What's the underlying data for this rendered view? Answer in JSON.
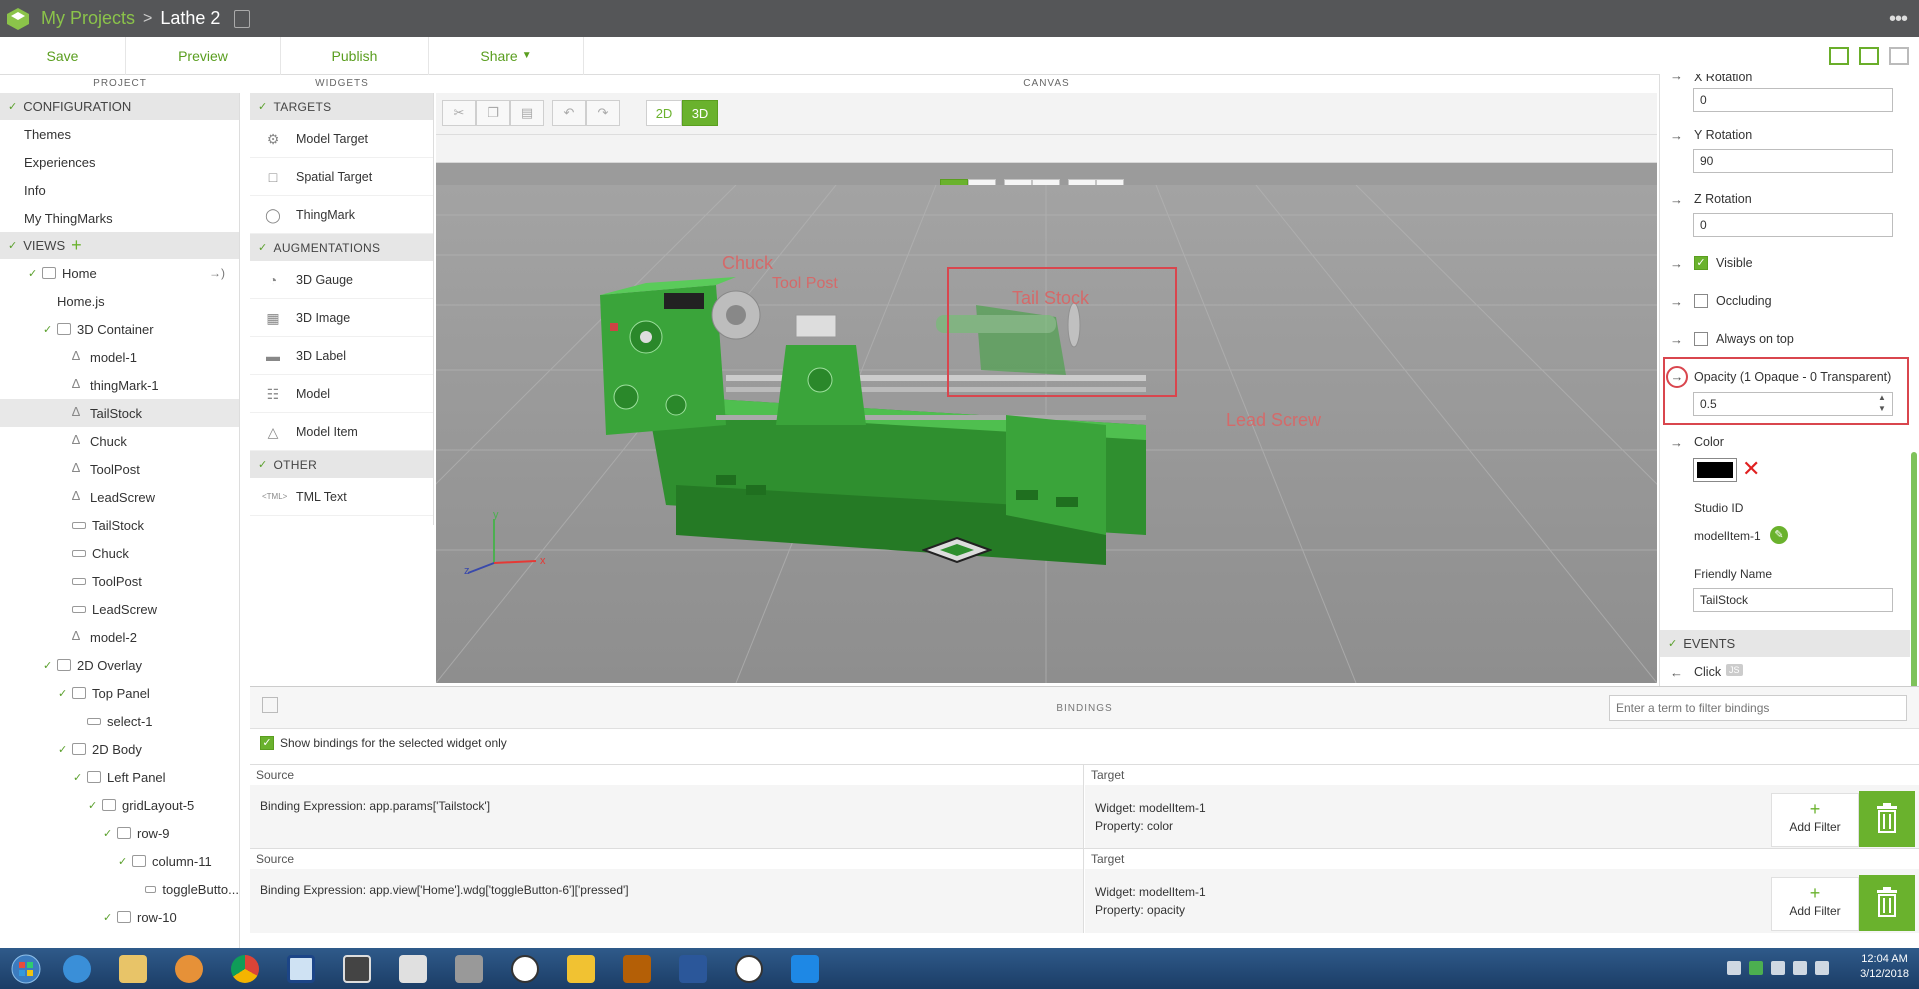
{
  "topbar": {
    "my_projects": "My Projects",
    "separator": ">",
    "project_name": "Lathe 2",
    "menu_icon": "•••"
  },
  "toolbar": {
    "save": "Save",
    "preview": "Preview",
    "publish": "Publish",
    "share": "Share"
  },
  "column_headers": {
    "project": "PROJECT",
    "widgets": "WIDGETS",
    "canvas": "CANVAS",
    "bindings": "BINDINGS"
  },
  "project": {
    "configuration": "CONFIGURATION",
    "config_items": [
      "Themes",
      "Experiences",
      "Info",
      "My ThingMarks"
    ],
    "views": "VIEWS",
    "tree": [
      {
        "label": "Home",
        "indent": 0
      },
      {
        "label": "Home.js",
        "indent": 1
      },
      {
        "label": "3D Container",
        "indent": 1
      },
      {
        "label": "model-1",
        "indent": 2
      },
      {
        "label": "thingMark-1",
        "indent": 2
      },
      {
        "label": "TailStock",
        "indent": 2
      },
      {
        "label": "Chuck",
        "indent": 2
      },
      {
        "label": "ToolPost",
        "indent": 2
      },
      {
        "label": "LeadScrew",
        "indent": 2
      },
      {
        "label": "TailStock",
        "indent": 2
      },
      {
        "label": "Chuck",
        "indent": 2
      },
      {
        "label": "ToolPost",
        "indent": 2
      },
      {
        "label": "LeadScrew",
        "indent": 2
      },
      {
        "label": "model-2",
        "indent": 2
      },
      {
        "label": "2D Overlay",
        "indent": 1
      },
      {
        "label": "Top Panel",
        "indent": 2
      },
      {
        "label": "select-1",
        "indent": 3
      },
      {
        "label": "2D Body",
        "indent": 2
      },
      {
        "label": "Left Panel",
        "indent": 3
      },
      {
        "label": "gridLayout-5",
        "indent": 4
      },
      {
        "label": "row-9",
        "indent": 5
      },
      {
        "label": "column-11",
        "indent": 6
      },
      {
        "label": "toggleButto...",
        "indent": 7
      },
      {
        "label": "row-10",
        "indent": 5
      }
    ]
  },
  "widgets": {
    "targets": "TARGETS",
    "target_items": [
      "Model Target",
      "Spatial Target",
      "ThingMark"
    ],
    "augmentations": "AUGMENTATIONS",
    "augmentation_items": [
      "3D Gauge",
      "3D Image",
      "3D Label",
      "Model",
      "Model Item"
    ],
    "other": "OTHER",
    "other_items": [
      "TML Text"
    ],
    "tml_prefix": "<TML>"
  },
  "canvas": {
    "mode_2d": "2D",
    "mode_3d": "3D",
    "labels": {
      "chuck": "Chuck",
      "toolpost": "Tool Post",
      "tailstock": "Tail Stock",
      "leadscrew": "Lead Screw"
    },
    "axes": {
      "x": "x",
      "y": "y",
      "z": "z"
    }
  },
  "properties": {
    "x_rotation_label": "X Rotation",
    "x_rotation": "0",
    "y_rotation_label": "Y Rotation",
    "y_rotation": "90",
    "z_rotation_label": "Z Rotation",
    "z_rotation": "0",
    "visible": "Visible",
    "occluding": "Occluding",
    "always_on_top": "Always on top",
    "opacity_label": "Opacity (1 Opaque - 0 Transparent)",
    "opacity": "0.5",
    "color_label": "Color",
    "studio_id_label": "Studio ID",
    "studio_id": "modelItem-1",
    "friendly_name_label": "Friendly Name",
    "friendly_name": "TailStock",
    "events": "EVENTS",
    "click": "Click",
    "js": "JS"
  },
  "bindings": {
    "filter_placeholder": "Enter a term to filter bindings",
    "show_selected": "Show bindings for the selected widget only",
    "rows": [
      {
        "source_head": "Source",
        "target_head": "Target",
        "expr_label": "Binding Expression:",
        "expr": "app.params['Tailstock']",
        "widget_label": "Widget:",
        "widget": "modelItem-1",
        "property_label": "Property:",
        "property": "color",
        "add_filter": "Add Filter"
      },
      {
        "source_head": "Source",
        "target_head": "Target",
        "expr_label": "Binding Expression:",
        "expr": "app.view['Home'].wdg['toggleButton-6']['pressed']",
        "widget_label": "Widget:",
        "widget": "modelItem-1",
        "property_label": "Property:",
        "property": "opacity",
        "add_filter": "Add Filter"
      }
    ]
  },
  "taskbar": {
    "time": "12:04 AM",
    "date": "3/12/2018"
  },
  "colors": {
    "accent": "#6ab22d",
    "topbar": "#555658",
    "highlight": "#d9464e",
    "lathe_green": "#3aa43a"
  }
}
